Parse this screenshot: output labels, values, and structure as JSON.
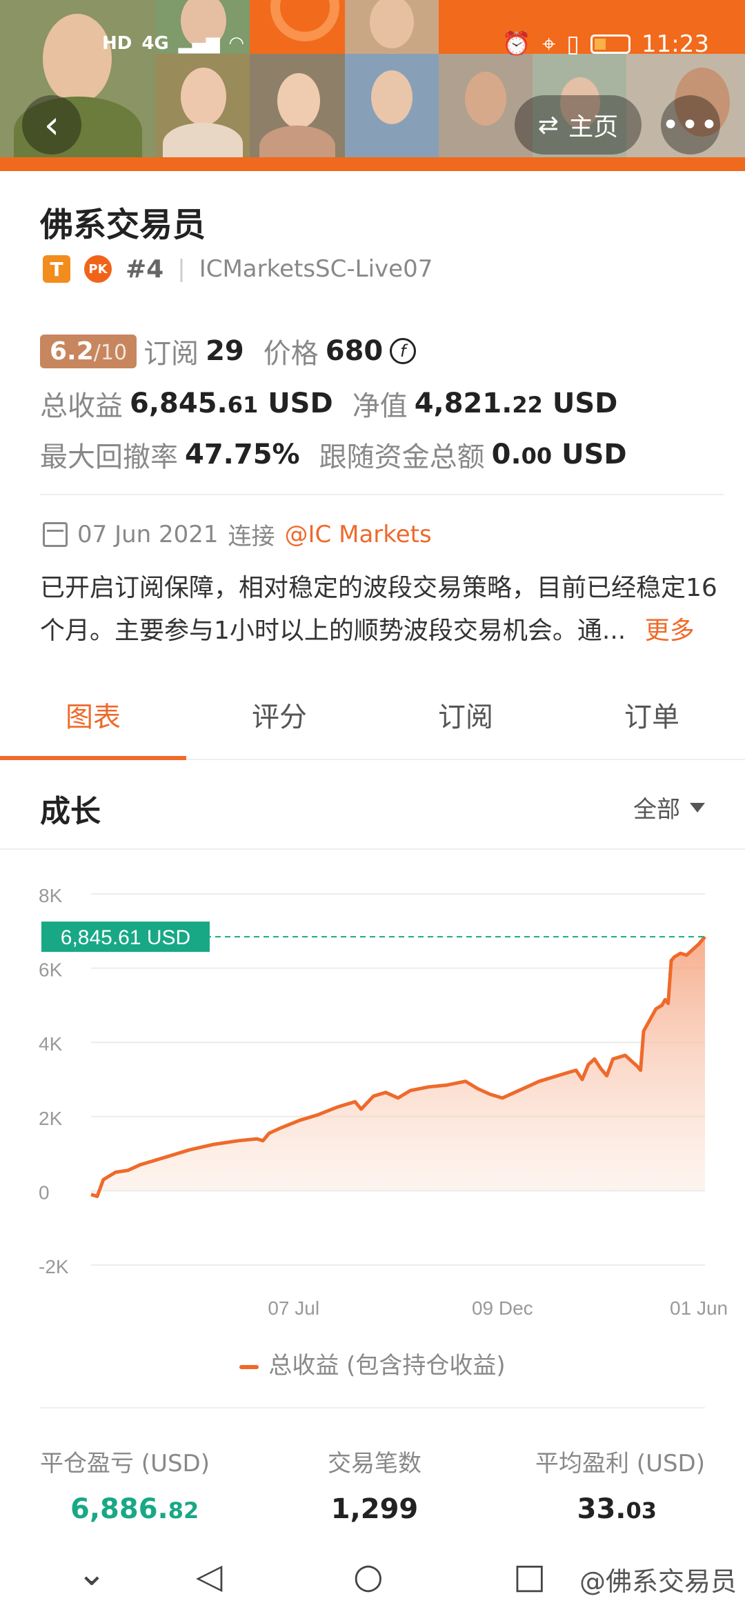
{
  "status_bar": {
    "signal_labels": [
      "HD",
      "4G"
    ],
    "time": "11:23"
  },
  "header": {
    "back_icon": "chevron-left-icon",
    "home_label": "主页",
    "home_icon": "swap-icon",
    "more_icon": "more-dots-icon"
  },
  "profile": {
    "name": "佛系交易员",
    "tier_badge": "T",
    "pk_badge": "PK",
    "rank": "#4",
    "server": "ICMarketsSC-Live07",
    "score": "6.2",
    "score_max": "/10",
    "subs_label": "订阅",
    "subs_value": "29",
    "price_label": "价格",
    "price_value": "680",
    "price_currency_symbol": "f",
    "total_profit_label": "总收益",
    "total_profit_int": "6,845.",
    "total_profit_dec": "61",
    "total_profit_unit": "USD",
    "net_value_label": "净值",
    "net_value_int": "4,821.",
    "net_value_dec": "22",
    "net_value_unit": "USD",
    "drawdown_label": "最大回撤率",
    "drawdown_value": "47.75%",
    "follow_label": "跟随资金总额",
    "follow_int": "0.",
    "follow_dec": "00",
    "follow_unit": "USD",
    "date": "07 Jun 2021",
    "connect_label": "连接",
    "broker": "@IC Markets",
    "description": "已开启订阅保障，相对稳定的波段交易策略，目前已经稳定16个月。主要参与1小时以上的顺势波段交易机会。通...",
    "more_label": "更多"
  },
  "tabs": [
    "图表",
    "评分",
    "订阅",
    "订单"
  ],
  "chart_section": {
    "title": "成长",
    "filter_label": "全部"
  },
  "chart_data": {
    "type": "area",
    "y_ticks": [
      "8K",
      "6K",
      "4K",
      "2K",
      "0",
      "-2K"
    ],
    "ylim": [
      -2000,
      8000
    ],
    "x_ticks": [
      "07 Jul",
      "09 Dec",
      "01 Jun"
    ],
    "x_tick_pos": [
      0.33,
      0.67,
      0.99
    ],
    "current_value_label": "6,845.61 USD",
    "current_value": 6845.61,
    "series": [
      {
        "name": "总收益 (包含持仓收益)",
        "color": "#ee6a2b",
        "points": [
          [
            0.0,
            -100
          ],
          [
            0.01,
            -150
          ],
          [
            0.02,
            300
          ],
          [
            0.04,
            500
          ],
          [
            0.06,
            550
          ],
          [
            0.08,
            700
          ],
          [
            0.1,
            800
          ],
          [
            0.13,
            950
          ],
          [
            0.16,
            1100
          ],
          [
            0.2,
            1250
          ],
          [
            0.24,
            1350
          ],
          [
            0.27,
            1400
          ],
          [
            0.28,
            1350
          ],
          [
            0.29,
            1550
          ],
          [
            0.31,
            1700
          ],
          [
            0.34,
            1900
          ],
          [
            0.37,
            2050
          ],
          [
            0.4,
            2250
          ],
          [
            0.43,
            2400
          ],
          [
            0.44,
            2200
          ],
          [
            0.46,
            2550
          ],
          [
            0.48,
            2650
          ],
          [
            0.5,
            2500
          ],
          [
            0.52,
            2700
          ],
          [
            0.55,
            2800
          ],
          [
            0.58,
            2850
          ],
          [
            0.61,
            2950
          ],
          [
            0.63,
            2750
          ],
          [
            0.65,
            2600
          ],
          [
            0.67,
            2500
          ],
          [
            0.69,
            2650
          ],
          [
            0.71,
            2800
          ],
          [
            0.73,
            2950
          ],
          [
            0.75,
            3050
          ],
          [
            0.77,
            3150
          ],
          [
            0.79,
            3250
          ],
          [
            0.8,
            3000
          ],
          [
            0.81,
            3400
          ],
          [
            0.82,
            3550
          ],
          [
            0.83,
            3300
          ],
          [
            0.84,
            3100
          ],
          [
            0.85,
            3550
          ],
          [
            0.86,
            3600
          ],
          [
            0.87,
            3650
          ],
          [
            0.88,
            3500
          ],
          [
            0.89,
            3350
          ],
          [
            0.895,
            3250
          ],
          [
            0.9,
            4300
          ],
          [
            0.91,
            4600
          ],
          [
            0.92,
            4900
          ],
          [
            0.93,
            5000
          ],
          [
            0.935,
            5150
          ],
          [
            0.94,
            5050
          ],
          [
            0.945,
            6200
          ],
          [
            0.95,
            6300
          ],
          [
            0.96,
            6400
          ],
          [
            0.97,
            6350
          ],
          [
            0.98,
            6500
          ],
          [
            0.99,
            6650
          ],
          [
            1.0,
            6845.61
          ]
        ]
      }
    ],
    "x_unit_note": "",
    "grid": true
  },
  "summary": {
    "closed_pl_label": "平仓盈亏 (USD)",
    "closed_pl_int": "6,886.",
    "closed_pl_dec": "82",
    "trades_label": "交易笔数",
    "trades_value": "1,299",
    "avg_profit_label": "平均盈利 (USD)",
    "avg_profit_int": "33.",
    "avg_profit_dec": "03"
  },
  "navbar": {
    "watermark": "@佛系交易员"
  },
  "colors": {
    "accent": "#ee6a2b",
    "positive": "#18a886",
    "score_bg": "#c7865e"
  }
}
